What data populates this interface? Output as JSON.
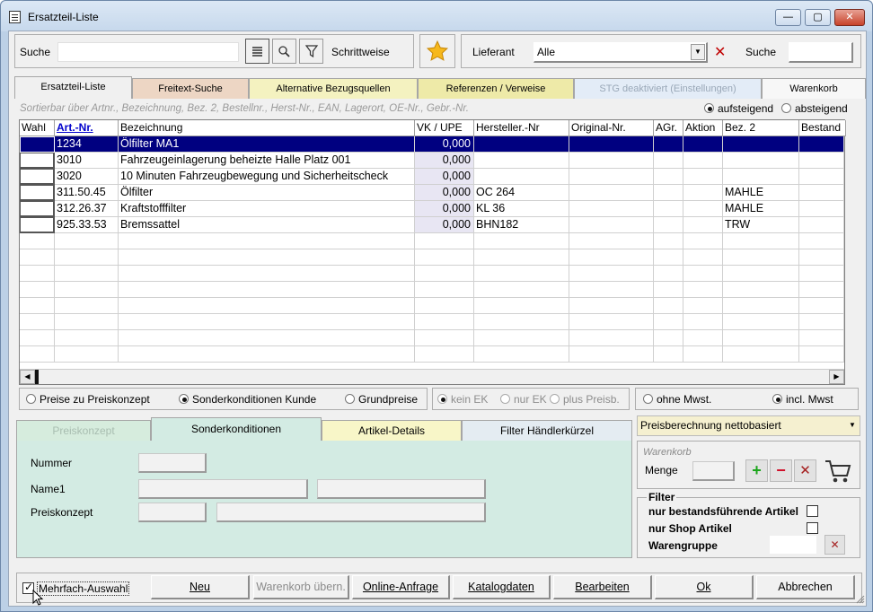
{
  "window": {
    "title": "Ersatzteil-Liste",
    "min_glyph": "—",
    "max_glyph": "▢",
    "close_glyph": "✕"
  },
  "search": {
    "label": "Suche",
    "value": "",
    "mode_label": "Schrittweise"
  },
  "supplier": {
    "label": "Lieferant",
    "value": "Alle",
    "search_label": "Suche",
    "search_value": ""
  },
  "tabs": [
    {
      "label": "Ersatzteil-Liste",
      "color": "#f0f0f0"
    },
    {
      "label": "Freitext-Suche",
      "color": "#edd6c4"
    },
    {
      "label": "Alternative Bezugsquellen",
      "color": "#f4f2c0"
    },
    {
      "label": "Referenzen / Verweise",
      "color": "#eeeaa8"
    },
    {
      "label": "STG deaktiviert (Einstellungen)",
      "color": "#e3ecf7"
    },
    {
      "label": "Warenkorb",
      "color": "#f7f7f7"
    }
  ],
  "sort_hint": "Sortierbar über Artnr., Bezeichnung, Bez. 2, Bestellnr., Herst-Nr., EAN, Lagerort, OE-Nr., Gebr.-Nr.",
  "sort": {
    "asc_label": "aufsteigend",
    "desc_label": "absteigend",
    "selected": "asc"
  },
  "table": {
    "columns": [
      "Wahl",
      "Art.-Nr.",
      "Bezeichnung",
      "VK / UPE",
      "Hersteller.-Nr",
      "Original-Nr.",
      "AGr.",
      "Aktion",
      "Bez. 2",
      "Bestand"
    ],
    "rows": [
      {
        "art": "1234",
        "bez": "Ölfilter MA1",
        "vk": "0,000",
        "herst": "",
        "orig": "",
        "agr": "",
        "aktion": "",
        "bez2": "",
        "bestand": "",
        "selected": true
      },
      {
        "art": "3010",
        "bez": "Fahrzeugeinlagerung beheizte Halle Platz 001",
        "vk": "0,000",
        "herst": "",
        "orig": "",
        "agr": "",
        "aktion": "",
        "bez2": "",
        "bestand": "",
        "selected": false
      },
      {
        "art": "3020",
        "bez": "10 Minuten Fahrzeugbewegung und Sicherheitscheck",
        "vk": "0,000",
        "herst": "",
        "orig": "",
        "agr": "",
        "aktion": "",
        "bez2": "",
        "bestand": "",
        "selected": false
      },
      {
        "art": "311.50.45",
        "bez": "Ölfilter",
        "vk": "0,000",
        "herst": "OC 264",
        "orig": "",
        "agr": "",
        "aktion": "",
        "bez2": "MAHLE",
        "bestand": "",
        "selected": false
      },
      {
        "art": "312.26.37",
        "bez": "Kraftstofffilter",
        "vk": "0,000",
        "herst": "KL 36",
        "orig": "",
        "agr": "",
        "aktion": "",
        "bez2": "MAHLE",
        "bestand": "",
        "selected": false
      },
      {
        "art": "925.33.53",
        "bez": "Bremssattel",
        "vk": "0,000",
        "herst": "BHN182",
        "orig": "",
        "agr": "",
        "aktion": "",
        "bez2": "TRW",
        "bestand": "",
        "selected": false
      }
    ]
  },
  "price_options": {
    "p1": "Preise zu Preiskonzept",
    "p2": "Sonderkonditionen Kunde",
    "p3": "Grundpreise",
    "selected": "p2",
    "ek1": "kein EK",
    "ek2": "nur EK",
    "ek3": "plus Preisb.",
    "mwst1": "ohne Mwst.",
    "mwst2": "incl. Mwst",
    "mwst_selected": "mwst2"
  },
  "lower_tabs": [
    {
      "label": "Preiskonzept",
      "color": "#d6ecdd"
    },
    {
      "label": "Sonderkonditionen",
      "color": "#d3ebe3"
    },
    {
      "label": "Artikel-Details",
      "color": "#f8f6c8"
    },
    {
      "label": "Filter Händlerkürzel",
      "color": "#e4ecf2"
    }
  ],
  "sonder": {
    "nummer_label": "Nummer",
    "name1_label": "Name1",
    "preiskonzept_label": "Preiskonzept"
  },
  "pricing_select": "Preisberechnung nettobasiert",
  "warenkorb": {
    "title": "Warenkorb",
    "menge_label": "Menge",
    "menge_value": "",
    "add": "+",
    "remove": "−",
    "clear": "✕"
  },
  "filter": {
    "title": "Filter",
    "stock_only": "nur bestandsführende Artikel",
    "shop_only": "nur Shop Artikel",
    "group_label": "Warengruppe",
    "group_value": ""
  },
  "footer": {
    "multi_select": "Mehrfach-Auswahl",
    "multi_checked": true,
    "neu": "Neu",
    "warenkorb": "Warenkorb übern.",
    "online": "Online-Anfrage",
    "katalog": "Katalogdaten",
    "bearbeiten": "Bearbeiten",
    "ok": "Ok",
    "abbrechen": "Abbrechen"
  }
}
